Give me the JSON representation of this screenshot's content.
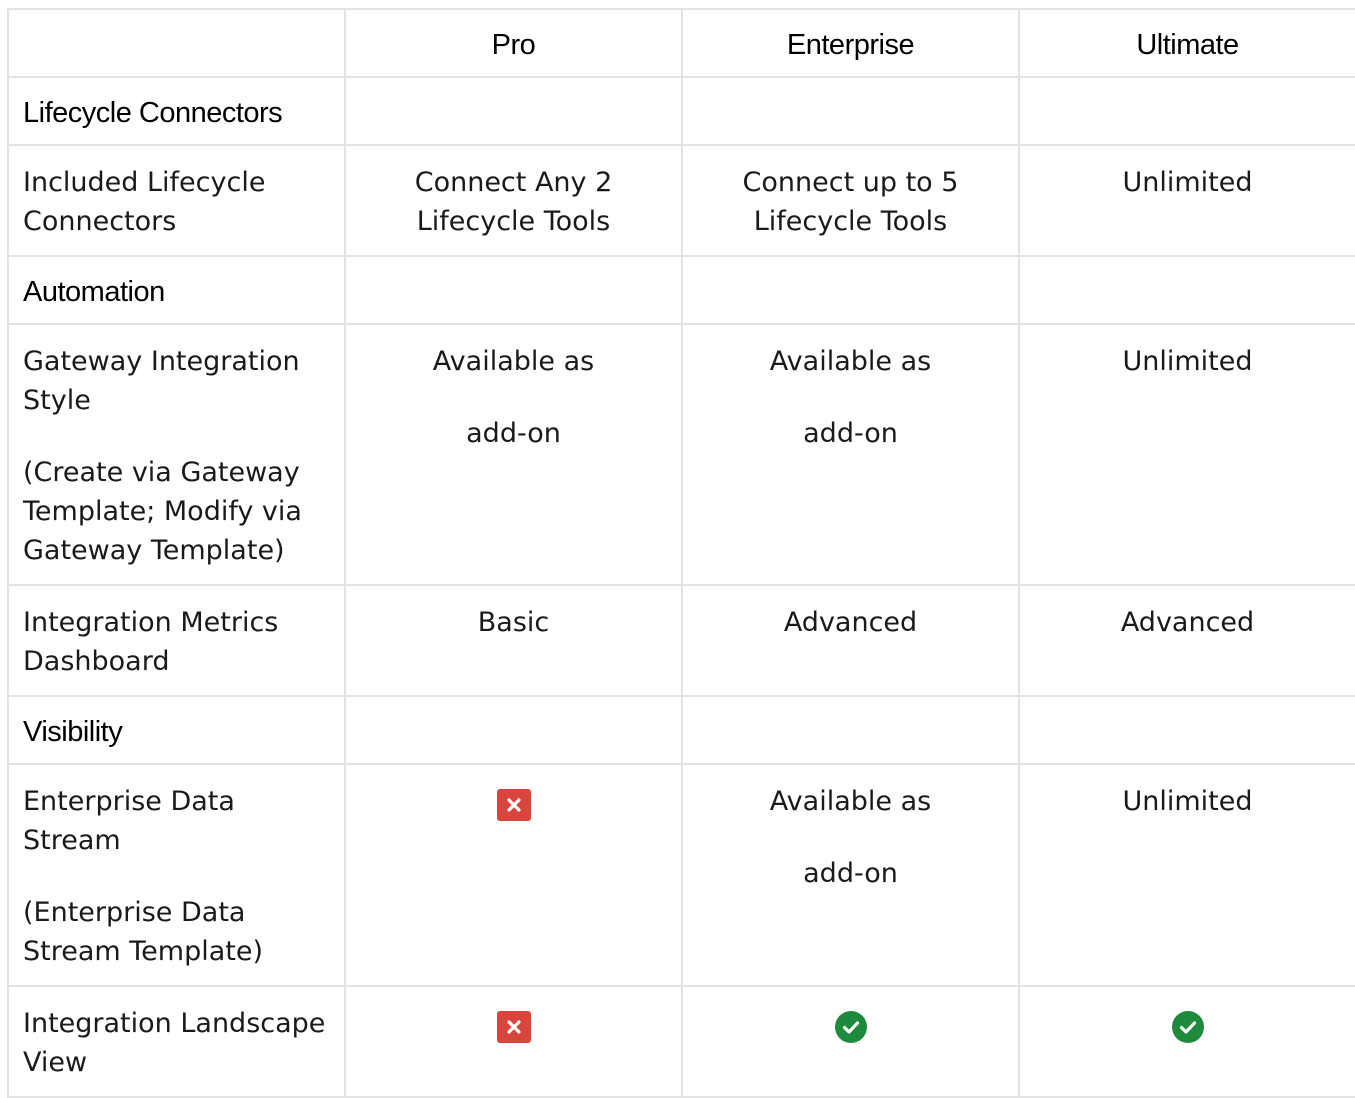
{
  "table": {
    "columns": [
      "",
      "Pro",
      "Enterprise",
      "Ultimate"
    ],
    "sections": [
      {
        "title": "Lifecycle Connectors",
        "rows": [
          {
            "feature": "Included Lifecycle Connectors",
            "note": "",
            "pro": {
              "type": "text",
              "text": "Connect Any 2 Lifecycle Tools"
            },
            "enterprise": {
              "type": "text",
              "text": "Connect up to 5 Lifecycle Tools"
            },
            "ultimate": {
              "type": "text",
              "text": "Unlimited"
            }
          }
        ]
      },
      {
        "title": "Automation",
        "rows": [
          {
            "feature": "Gateway Integration Style",
            "note": "(Create via Gateway Template; Modify via Gateway Template)",
            "pro": {
              "type": "addon",
              "line1": "Available as",
              "line2": "add-on"
            },
            "enterprise": {
              "type": "addon",
              "line1": "Available as",
              "line2": "add-on"
            },
            "ultimate": {
              "type": "text",
              "text": "Unlimited"
            }
          },
          {
            "feature": "Integration Metrics Dashboard",
            "note": "",
            "pro": {
              "type": "text",
              "text": "Basic"
            },
            "enterprise": {
              "type": "text",
              "text": "Advanced"
            },
            "ultimate": {
              "type": "text",
              "text": "Advanced"
            }
          }
        ]
      },
      {
        "title": "Visibility",
        "rows": [
          {
            "feature": "Enterprise Data Stream",
            "note": "(Enterprise Data Stream Template)",
            "pro": {
              "type": "icon",
              "icon": "cross-icon"
            },
            "enterprise": {
              "type": "addon",
              "line1": "Available as",
              "line2": "add-on"
            },
            "ultimate": {
              "type": "text",
              "text": "Unlimited"
            }
          },
          {
            "feature": "Integration Landscape View",
            "note": "",
            "pro": {
              "type": "icon",
              "icon": "cross-icon"
            },
            "enterprise": {
              "type": "icon",
              "icon": "check-icon"
            },
            "ultimate": {
              "type": "icon",
              "icon": "check-icon"
            }
          }
        ]
      }
    ]
  },
  "colors": {
    "border": "#e3e3e3",
    "cross": "#d9453d",
    "check": "#1e8a3c"
  }
}
